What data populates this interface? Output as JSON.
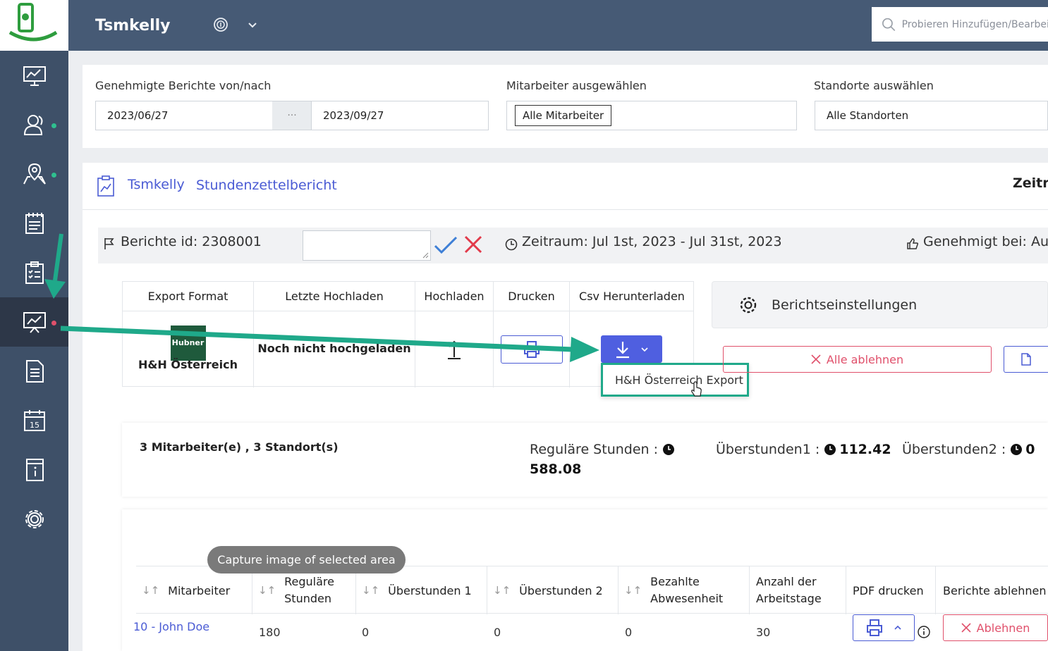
{
  "header": {
    "app_title": "Tsmkelly",
    "search_placeholder": "Probieren Hinzufügen/Bearbeiten"
  },
  "filters": {
    "date_label": "Genehmigte Berichte von/nach",
    "date_from": "2023/06/27",
    "date_sep": "···",
    "date_to": "2023/09/27",
    "employee_label": "Mitarbeiter ausgewählen",
    "employee_value": "Alle Mitarbeiter",
    "location_label": "Standorte auswählen",
    "location_value": "Alle Standorten"
  },
  "report": {
    "company": "Tsmkelly",
    "title": "Stundenzettelbericht",
    "right_label": "Zeitra",
    "report_id": "Berichte id: 2308001",
    "period": "Zeitraum: Jul 1st, 2023 - Jul 31st, 2023",
    "approved": "Genehmigt bei: Au"
  },
  "export_table": {
    "headers": [
      "Export Format",
      "Letzte Hochladen",
      "Hochladen",
      "Drucken",
      "Csv Herunterladen"
    ],
    "format_name": "H&H Österreich",
    "logo_text": "Hubner",
    "last_upload": "Noch nicht hochgeladen",
    "dropdown_item": "H&H Österreich Export"
  },
  "actions": {
    "settings": "Berichtseinstellungen",
    "reject_all": "Alle ablehnen"
  },
  "summary": {
    "counts": "3 Mitarbeiter(e) , 3 Standort(s)",
    "regular_label": "Reguläre Stunden :",
    "regular_value": "588.08",
    "ot1_label": "Überstunden1 :",
    "ot1_value": "112.42",
    "ot2_label": "Überstunden2 :",
    "ot2_value": "0"
  },
  "employees": {
    "headers": {
      "employee": "Mitarbeiter",
      "regular": "Reguläre Stunden",
      "ot1": "Überstunden 1",
      "ot2": "Überstunden 2",
      "paid_absence": "Bezahlte Abwesenheit",
      "workdays": "Anzahl der Arbeitstage",
      "pdf": "PDF drucken",
      "reject": "Berichte ablehnen"
    },
    "rows": [
      {
        "employee": "10 - John Doe",
        "regular": "180",
        "ot1": "0",
        "ot2": "0",
        "paid_absence": "0",
        "workdays": "30",
        "reject_label": "Ablehnen"
      }
    ]
  },
  "tooltip": "Capture image of selected area",
  "colors": {
    "sidebar": "#3e5068",
    "header": "#465a75",
    "accent": "#4f5fe0",
    "highlight": "#1fa98a",
    "danger": "#e0506b"
  }
}
